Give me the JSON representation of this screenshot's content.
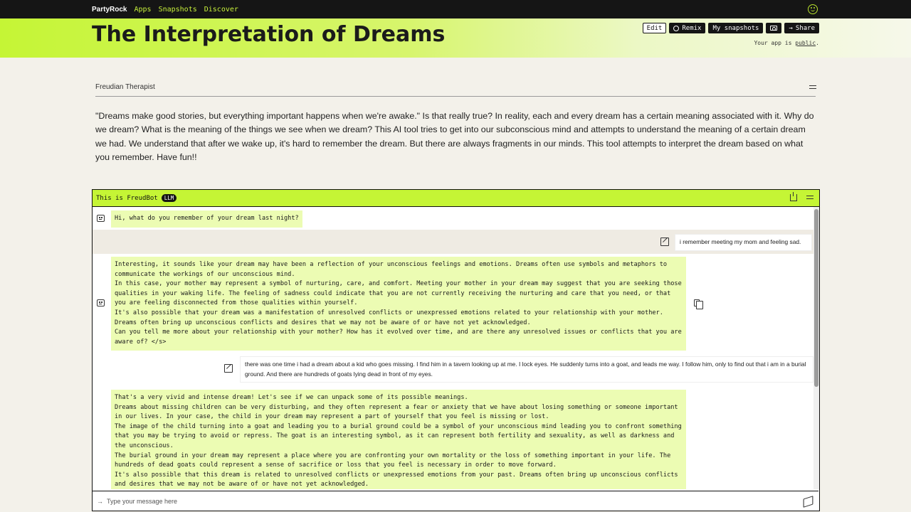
{
  "nav": {
    "brand": "PartyRock",
    "links": [
      "Apps",
      "Snapshots",
      "Discover"
    ],
    "avatar_icon": "smiley-icon"
  },
  "header": {
    "title": "The Interpretation of Dreams",
    "buttons": {
      "edit": "Edit",
      "remix": "Remix",
      "snapshots": "My snapshots",
      "share": "Share"
    },
    "public_prefix": "Your app is",
    "public_link": "public",
    "public_suffix": ".",
    "accent_color": "#c5f535"
  },
  "section": {
    "title": "Freudian Therapist",
    "description": "\"Dreams make good stories, but everything important happens when we're awake.\" Is that really true? In reality, each and every dream has a certain meaning associated with it. Why do we dream? What is the meaning of the things we see when we dream? This AI tool tries to get into our subconscious mind and attempts to understand the meaning of a certain dream we had. We understand that after we wake up, it's hard to remember the dream. But there are always fragments in our minds. This tool attempts to interpret the dream based on what you remember. Have fun!!"
  },
  "chat": {
    "title": "This is FreudBot",
    "badge": "LLM",
    "input_placeholder": "Type your message here",
    "messages": [
      {
        "role": "bot",
        "lines": [
          "Hi, what do you remember of your dream last night?"
        ]
      },
      {
        "role": "user",
        "text": "i remember meeting my mom and feeling sad."
      },
      {
        "role": "bot",
        "lines": [
          "Interesting, it sounds like your dream may have been a reflection of your unconscious feelings and emotions. Dreams often use symbols and metaphors to communicate the workings of our unconscious mind.",
          "In this case, your mother may represent a symbol of nurturing, care, and comfort. Meeting your mother in your dream may suggest that you are seeking those qualities in your waking life. The feeling of sadness could indicate that you are not currently receiving the nurturing and care that you need, or that you are feeling disconnected from those qualities within yourself.",
          "It's also possible that your dream was a manifestation of unresolved conflicts or unexpressed emotions related to your relationship with your mother. Dreams often bring up unconscious conflicts and desires that we may not be aware of or have not yet acknowledged.",
          "Can you tell me more about your relationship with your mother? How has it evolved over time, and are there any unresolved issues or conflicts that you are aware of? </s>"
        ]
      },
      {
        "role": "user",
        "text": "there was one time i had a dream about a kid who goes missing. I find him in a tavern looking up at me. I lock eyes. He suddenly turns into a goat, and leads me way. I follow him, only to find out that i am in a burial ground. And there are hundreds of goats lying dead in front of my eyes."
      },
      {
        "role": "bot",
        "lines": [
          "That's a very vivid and intense dream! Let's see if we can unpack some of its possible meanings.",
          "Dreams about missing children can be very disturbing, and they often represent a fear or anxiety that we have about losing something or someone important in our lives. In your case, the child in your dream may represent a part of yourself that you feel is missing or lost.",
          "The image of the child turning into a goat and leading you to a burial ground could be a symbol of your unconscious mind leading you to confront something that you may be trying to avoid or repress. The goat is an interesting symbol, as it can represent both fertility and sexuality, as well as darkness and the unconscious.",
          "The burial ground in your dream may represent a place where you are confronting your own mortality or the loss of something important in your life. The hundreds of dead goats could represent a sense of sacrifice or loss that you feel is necessary in order to move forward.",
          "It's also possible that this dream is related to unresolved conflicts or unexpressed emotions from your past. Dreams often bring up unconscious conflicts and desires that we may not be aware of or have not yet acknowledged."
        ]
      }
    ]
  }
}
